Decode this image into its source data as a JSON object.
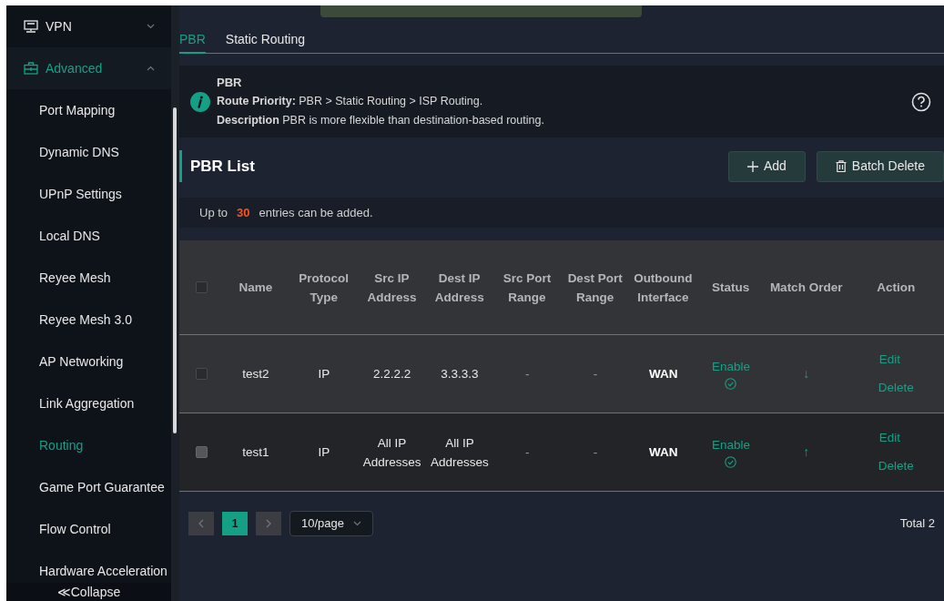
{
  "sidebar": {
    "items": [
      {
        "label": "VPN",
        "expanded": false,
        "selected": false
      },
      {
        "label": "Advanced",
        "expanded": true,
        "selected": true,
        "children": [
          {
            "label": "Port Mapping",
            "selected": false
          },
          {
            "label": "Dynamic DNS",
            "selected": false
          },
          {
            "label": "UPnP Settings",
            "selected": false
          },
          {
            "label": "Local DNS",
            "selected": false
          },
          {
            "label": "Reyee Mesh",
            "selected": false
          },
          {
            "label": "Reyee Mesh 3.0",
            "selected": false
          },
          {
            "label": "AP Networking",
            "selected": false
          },
          {
            "label": "Link Aggregation",
            "selected": false
          },
          {
            "label": "Routing",
            "selected": true
          },
          {
            "label": "Game Port Guarantee",
            "selected": false
          },
          {
            "label": "Flow Control",
            "selected": false
          },
          {
            "label": "Hardware Acceleration",
            "selected": false
          }
        ]
      }
    ],
    "collapse": "≪Collapse"
  },
  "tabs": [
    {
      "label": "PBR",
      "selected": true
    },
    {
      "label": "Static Routing",
      "selected": false
    }
  ],
  "info": {
    "title": "PBR",
    "lines": [
      "**Route Priority:** PBR > Static Routing > ISP Routing.",
      "**Description** PBR is more flexible than destination-based routing."
    ]
  },
  "section": {
    "title": "PBR List",
    "buttons": [
      "Add",
      "Batch Delete"
    ]
  },
  "note": {
    "before": "Up to",
    "count": "30",
    "after": "entries can be added."
  },
  "table": {
    "select_all": {
      "checked": false,
      "disabled": true
    },
    "columns": [
      "Name",
      "Protocol Type",
      "Src IP Address",
      "Dest IP Address",
      "Src Port Range",
      "Dest Port Range",
      "Outbound Interface",
      "Status",
      "Match Order",
      "Action"
    ],
    "rows": [
      {
        "checked": false,
        "disabled": true,
        "name": "test2",
        "protocol": "IP",
        "src_ip": "2.2.2.2",
        "dest_ip": "3.3.3.3",
        "src_port": "-",
        "dest_port": "-",
        "interface": "WAN",
        "status": "Enable",
        "enabled": true,
        "match_order": "↓",
        "actions": [
          "Edit",
          "Delete"
        ]
      },
      {
        "checked": false,
        "disabled": false,
        "name": "test1",
        "protocol": "IP",
        "src_ip": "All IP Addresses",
        "dest_ip": "All IP Addresses",
        "src_port": "-",
        "dest_port": "-",
        "interface": "WAN",
        "status": "Enable",
        "enabled": true,
        "match_order": "↑",
        "actions": [
          "Edit",
          "Delete"
        ]
      }
    ]
  },
  "pagination": {
    "pages": [
      {
        "label": "1",
        "selected": true
      }
    ],
    "page_size": "10/page",
    "total": "Total 2"
  }
}
